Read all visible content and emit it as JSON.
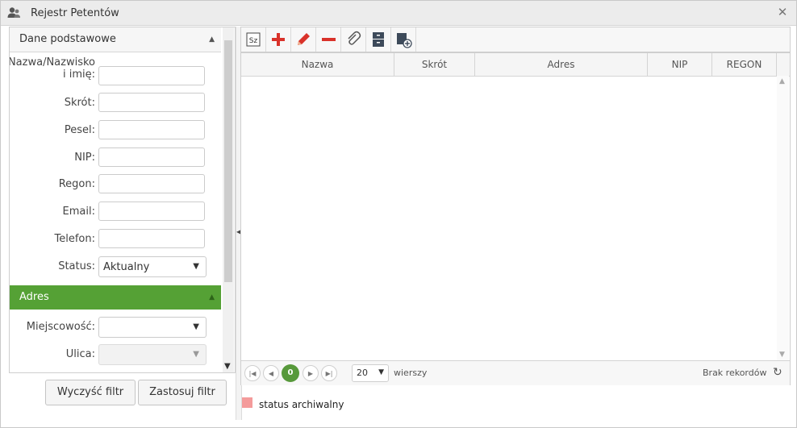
{
  "window": {
    "title": "Rejestr Petentów",
    "title_icon": "users-icon",
    "close_icon": "close-icon"
  },
  "filter": {
    "section_basic": "Dane podstawowe",
    "section_address": "Adres",
    "section_address_color": "#55a135",
    "fields": {
      "name_line1": "Nazwa/Nazwisko",
      "name_line2": "i imię:",
      "short": "Skrót:",
      "pesel": "Pesel:",
      "nip": "NIP:",
      "regon": "Regon:",
      "email": "Email:",
      "phone": "Telefon:",
      "status": "Status:",
      "status_value": "Aktualny",
      "city": "Miejscowość:",
      "street": "Ulica:"
    },
    "clear_button": "Wyczyść filtr",
    "apply_button": "Zastosuj filtr"
  },
  "toolbar": {
    "buttons": [
      "sz-icon",
      "add-icon",
      "edit-icon",
      "remove-icon",
      "attachment-icon",
      "archive-icon",
      "new-record-icon"
    ],
    "sz_label": "Sz"
  },
  "grid": {
    "columns": [
      "Nazwa",
      "Skrót",
      "Adres",
      "NIP",
      "REGON"
    ],
    "rows": []
  },
  "pager": {
    "current_page": "0",
    "page_size": "20",
    "rows_label": "wierszy",
    "info": "Brak rekordów",
    "accent": "#57993b"
  },
  "legend": {
    "text": "status archiwalny",
    "color": "#f49b9b"
  }
}
